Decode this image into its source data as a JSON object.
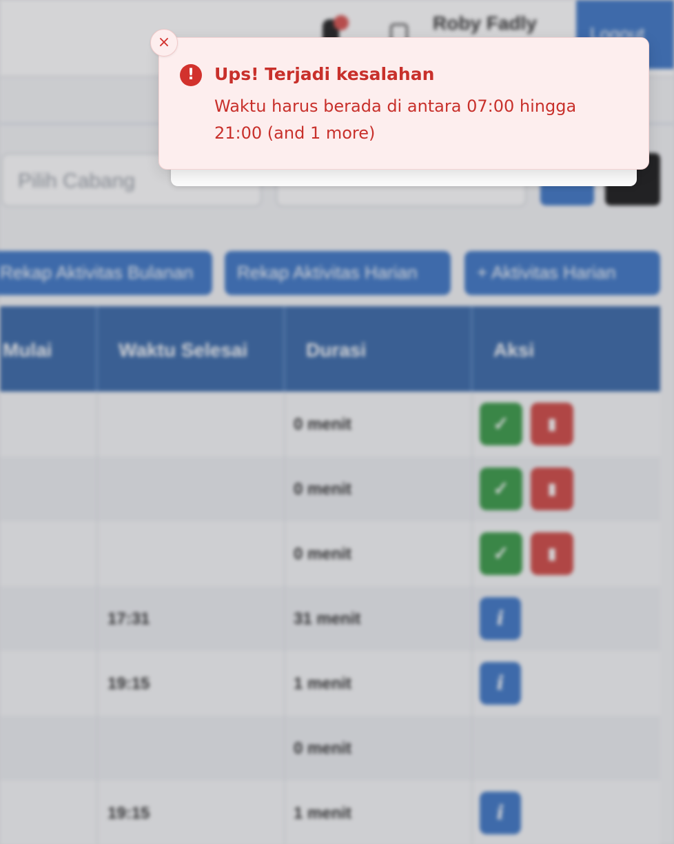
{
  "header": {
    "user_name": "Roby Fadly",
    "logout_label": "Logout"
  },
  "filters": {
    "branch_placeholder": "Pilih Cabang"
  },
  "actions": {
    "rekap_bulanan": "Rekap Aktivitas Bulanan",
    "rekap_harian": "Rekap Aktivitas Harian",
    "add_harian": "+ Aktivitas Harian"
  },
  "table": {
    "columns": {
      "mulai": "Mulai",
      "selesai": "Waktu Selesai",
      "durasi": "Durasi",
      "aksi": "Aksi"
    },
    "rows": [
      {
        "waktu_selesai": "",
        "durasi": "0 menit",
        "aksi": "approve-delete"
      },
      {
        "waktu_selesai": "",
        "durasi": "0 menit",
        "aksi": "approve-delete"
      },
      {
        "waktu_selesai": "",
        "durasi": "0 menit",
        "aksi": "approve-delete"
      },
      {
        "waktu_selesai": "17:31",
        "durasi": "31 menit",
        "aksi": "info"
      },
      {
        "waktu_selesai": "19:15",
        "durasi": "1 menit",
        "aksi": "info"
      },
      {
        "waktu_selesai": "",
        "durasi": "0 menit",
        "aksi": "none"
      },
      {
        "waktu_selesai": "19:15",
        "durasi": "1 menit",
        "aksi": "info"
      }
    ]
  },
  "toast": {
    "title": "Ups! Terjadi kesalahan",
    "message": "Waktu harus berada di antara 07:00 hingga 21:00 (and 1 more)",
    "close_symbol": "×",
    "icon_symbol": "!"
  },
  "icons": {
    "check": "✓",
    "trash": "▮",
    "info": "i"
  },
  "colors": {
    "primary": "#3f78c7",
    "success": "#3a9b48",
    "danger": "#d14a46",
    "toast_bg": "#fdeeee",
    "toast_text": "#c8302b"
  }
}
